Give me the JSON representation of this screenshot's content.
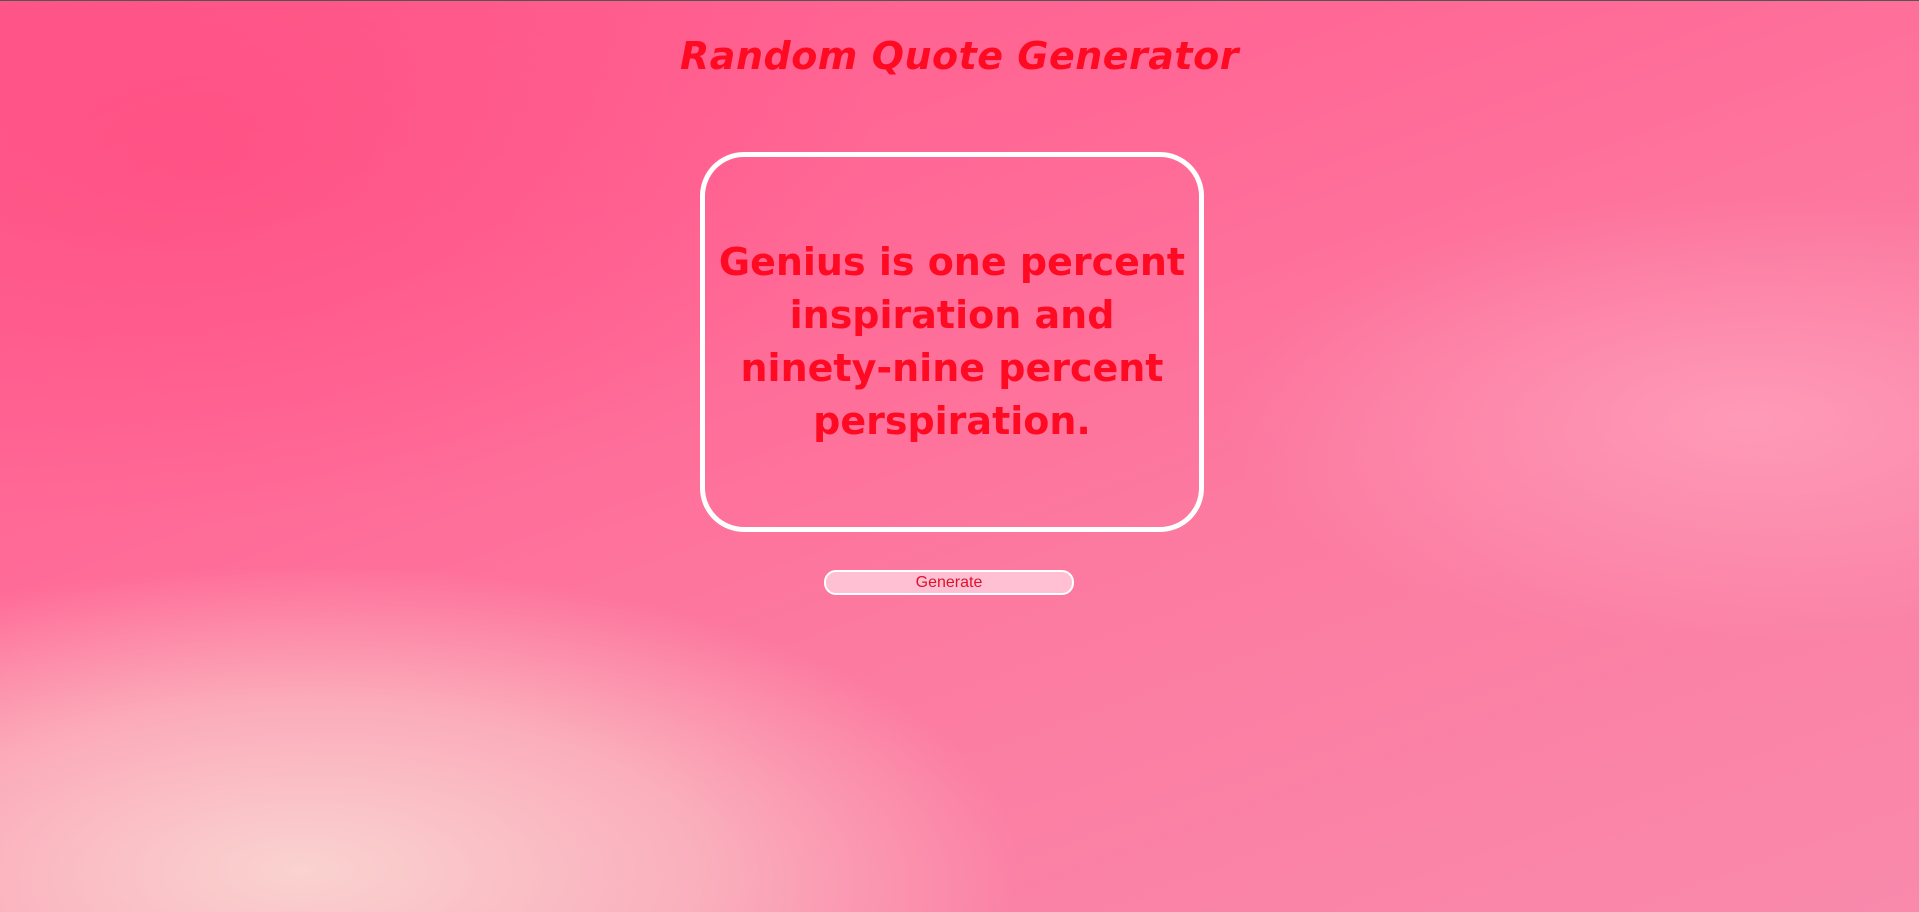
{
  "page": {
    "title": "Random Quote Generator"
  },
  "quote": {
    "text": "Genius is one percent inspiration and ninety-nine percent perspiration."
  },
  "actions": {
    "generate_label": "Generate"
  },
  "colors": {
    "text": "#ff0a23",
    "background": "#ff6a97",
    "border": "#ffffff"
  }
}
